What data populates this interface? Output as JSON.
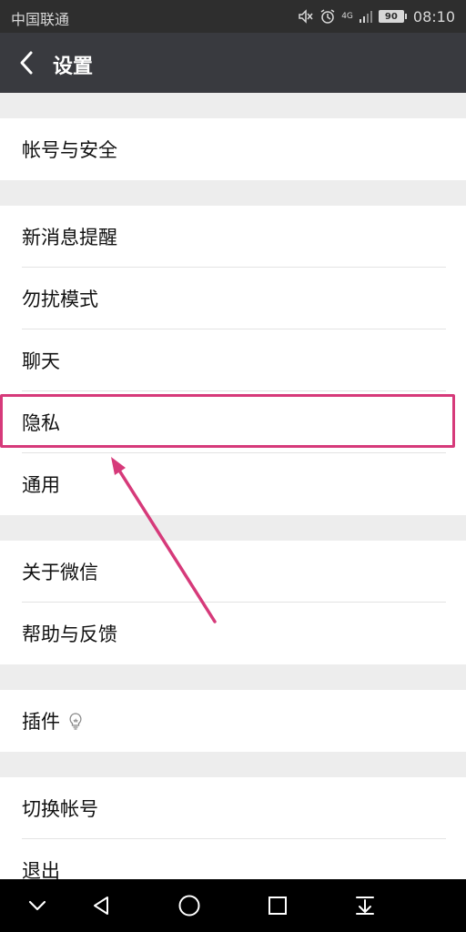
{
  "status_bar": {
    "carrier": "中国联通",
    "network": "4G",
    "battery": "90",
    "time": "08:10"
  },
  "header": {
    "title": "设置"
  },
  "groups": [
    {
      "items": [
        "帐号与安全"
      ]
    },
    {
      "items": [
        "新消息提醒",
        "勿扰模式",
        "聊天",
        "隐私",
        "通用"
      ]
    },
    {
      "items": [
        "关于微信",
        "帮助与反馈"
      ]
    },
    {
      "items": [
        "插件"
      ]
    },
    {
      "items": [
        "切换帐号",
        "退出"
      ]
    }
  ],
  "annotation": {
    "color": "#d63a7a",
    "highlighted_item": "隐私"
  },
  "colors": {
    "title_bar": "#393a3f",
    "status_bar": "#2e2e2e",
    "background": "#ededed"
  }
}
